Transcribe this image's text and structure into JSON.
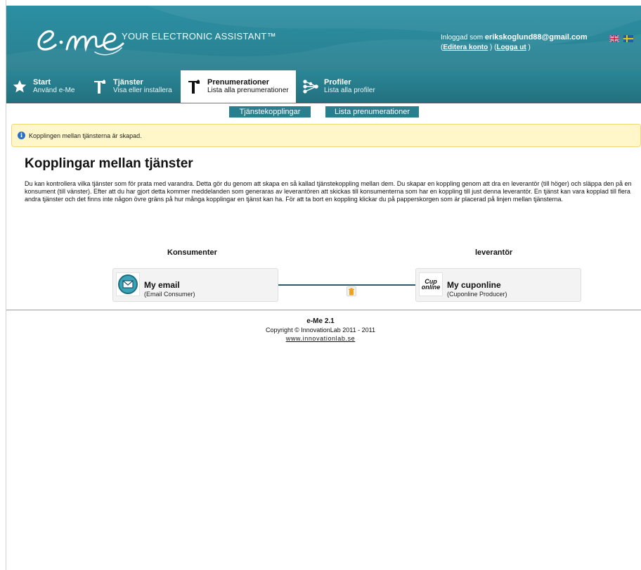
{
  "header": {
    "tagline": "YOUR ELECTRONIC ASSISTANT™",
    "login_prefix": "Inloggad som",
    "user_email": "erikskoglund88@gmail.com",
    "edit_account": "Editera konto",
    "logout": "Logga ut",
    "flag_en": "flag-uk-icon",
    "flag_sv": "flag-sweden-icon"
  },
  "nav": {
    "items": [
      {
        "title": "Start",
        "subtitle": "Använd e-Me",
        "icon": "star-icon"
      },
      {
        "title": "Tjänster",
        "subtitle": "Visa eller installera",
        "icon": "hammer-icon"
      },
      {
        "title": "Prenumerationer",
        "subtitle": "Lista alla prenumerationer",
        "icon": "hammer-icon"
      },
      {
        "title": "Profiler",
        "subtitle": "Lista alla profiler",
        "icon": "share-icon"
      }
    ],
    "active": "Prenumerationer"
  },
  "subnav": {
    "tabs": [
      "Tjänstekopplingar",
      "Lista prenumerationer"
    ]
  },
  "notice": {
    "message": "Kopplingen mellan tjänsterna är skapad."
  },
  "main": {
    "title": "Kopplingar mellan tjänster",
    "description": "Du kan kontrollera vilka tjänster som för prata med varandra. Detta gör du genom att skapa en så kallad tjänstekoppling mellan dem. Du skapar en koppling genom att dra en leverantör (till höger) och släppa den på en konsument (till vänster). Efter att du har gjort detta kommer meddelanden som generaras av leverantören att skickas till konsumenterna som har en koppling till just denna leverantör. En tjänst kan vara kopplad till flera andra tjänster och det finns inte någon övre gräns på hur många kopplingar en tjänst kan ha. För att ta bort en koppling klickar du på papperskorgen som är placerad på linjen mellan tjänsterna.",
    "consumers_heading": "Konsumenter",
    "providers_heading": "leverantör",
    "consumer": {
      "name": "My email",
      "type": "(Email Consumer)",
      "icon": "email-icon"
    },
    "provider": {
      "name": "My cuponline",
      "type": "(Cuponline Producer)",
      "logo_line1": "Cup",
      "logo_line2": "online"
    }
  },
  "footer": {
    "version": "e-Me 2.1",
    "copyright": "Copyright © InnovationLab 2011 - 2011",
    "link": "www.innovationlab.se"
  },
  "colors": {
    "brand_teal": "#2a8798",
    "notice_bg": "#fff7c9",
    "link_line": "#2a5b6a"
  }
}
